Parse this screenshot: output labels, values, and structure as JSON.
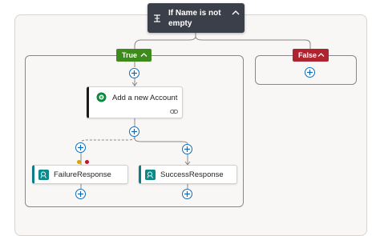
{
  "condition": {
    "title": "If Name is not empty",
    "icon": "condition-icon"
  },
  "branches": {
    "true_label": "True",
    "false_label": "False"
  },
  "actions": {
    "add_account": {
      "label": "Add a new Account",
      "icon": "dataverse-icon"
    },
    "failure": {
      "label": "FailureResponse",
      "icon": "response-icon"
    },
    "success": {
      "label": "SuccessResponse",
      "icon": "response-icon"
    }
  },
  "colors": {
    "true": "#3e8a1d",
    "false": "#b0242f",
    "condition": "#3b3f4a",
    "plus": "#0f6cbd",
    "response": "#0e8a8a",
    "run_after_failed": "#c8102e",
    "run_after_timed_out": "#d9a400"
  }
}
